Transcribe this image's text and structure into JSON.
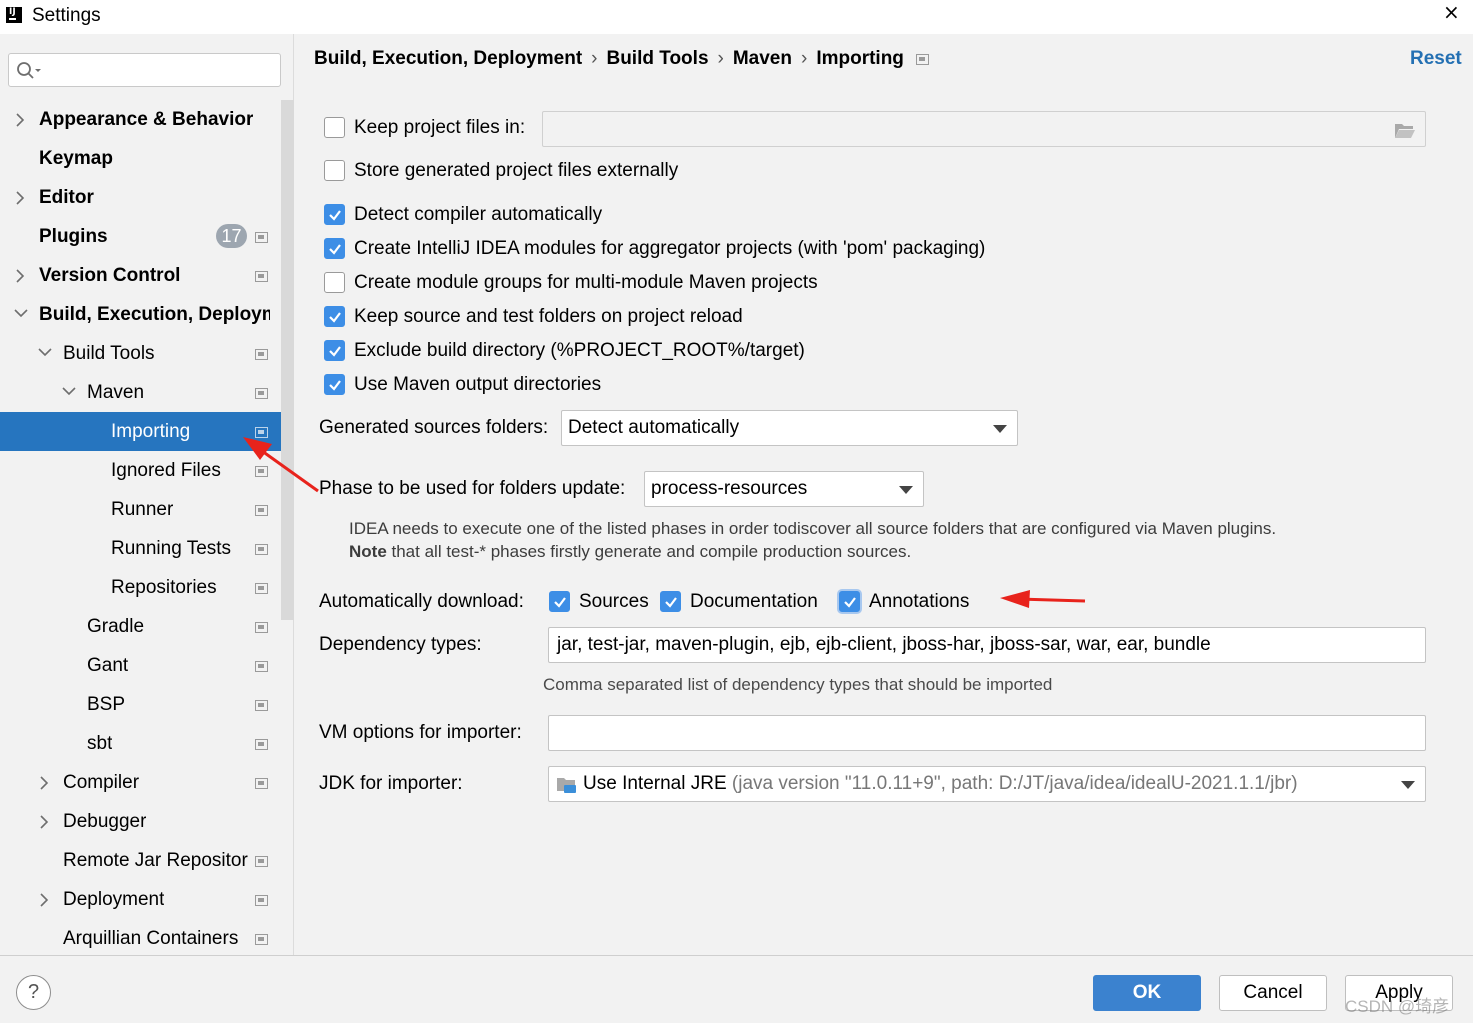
{
  "window": {
    "title": "Settings",
    "close_glyph": "×"
  },
  "search": {
    "placeholder": "",
    "icon": "search-icon"
  },
  "sidebar": {
    "items": [
      {
        "label": "Appearance & Behavior"
      },
      {
        "label": "Keymap"
      },
      {
        "label": "Editor"
      },
      {
        "label": "Plugins",
        "badge": "17"
      },
      {
        "label": "Version Control"
      },
      {
        "label": "Build, Execution, Deployment"
      },
      {
        "label": "Build Tools"
      },
      {
        "label": "Maven"
      },
      {
        "label": "Importing"
      },
      {
        "label": "Ignored Files"
      },
      {
        "label": "Runner"
      },
      {
        "label": "Running Tests"
      },
      {
        "label": "Repositories"
      },
      {
        "label": "Gradle"
      },
      {
        "label": "Gant"
      },
      {
        "label": "BSP"
      },
      {
        "label": "sbt"
      },
      {
        "label": "Compiler"
      },
      {
        "label": "Debugger"
      },
      {
        "label": "Remote Jar Repositories"
      },
      {
        "label": "Deployment"
      },
      {
        "label": "Arquillian Containers"
      }
    ]
  },
  "breadcrumb": {
    "parts": [
      "Build, Execution, Deployment",
      "Build Tools",
      "Maven",
      "Importing"
    ],
    "separator": "›"
  },
  "reset_label": "Reset",
  "options": {
    "keep_project_files": {
      "label": "Keep project files in:",
      "checked": false,
      "value": ""
    },
    "store_external": {
      "label": "Store generated project files externally",
      "checked": false
    },
    "detect_compiler": {
      "label": "Detect compiler automatically",
      "checked": true
    },
    "create_modules": {
      "label": "Create IntelliJ IDEA modules for aggregator projects (with 'pom' packaging)",
      "checked": true
    },
    "module_groups": {
      "label": "Create module groups for multi-module Maven projects",
      "checked": false
    },
    "keep_source": {
      "label": "Keep source and test folders on project reload",
      "checked": true
    },
    "exclude_build": {
      "label": "Exclude build directory (%PROJECT_ROOT%/target)",
      "checked": true
    },
    "use_output": {
      "label": "Use Maven output directories",
      "checked": true
    }
  },
  "generated_sources": {
    "label": "Generated sources folders:",
    "value": "Detect automatically"
  },
  "phase": {
    "label": "Phase to be used for folders update:",
    "value": "process-resources",
    "note_line1": "IDEA needs to execute one of the listed phases in order todiscover all source folders that are configured via Maven plugins.",
    "note_bold": "Note",
    "note_line2": " that all test-* phases firstly generate and compile production sources."
  },
  "auto_download": {
    "label": "Automatically download:",
    "sources": "Sources",
    "documentation": "Documentation",
    "annotations": "Annotations"
  },
  "dependency_types": {
    "label": "Dependency types:",
    "value": "jar, test-jar, maven-plugin, ejb, ejb-client, jboss-har, jboss-sar, war, ear, bundle",
    "hint": "Comma separated list of dependency types that should be imported"
  },
  "vm_options": {
    "label": "VM options for importer:",
    "value": ""
  },
  "jdk": {
    "label": "JDK for importer:",
    "value": "Use Internal JRE",
    "detail": "(java version \"11.0.11+9\", path: D:/JT/java/idea/idealU-2021.1.1/jbr)"
  },
  "buttons": {
    "help": "?",
    "ok": "OK",
    "cancel": "Cancel",
    "apply": "Apply"
  },
  "watermark": "CSDN @琦彦",
  "colors": {
    "accent": "#2675bf",
    "checkbox": "#3d8ee6",
    "link": "#2470b3",
    "annotation_arrow": "#e8231c"
  }
}
